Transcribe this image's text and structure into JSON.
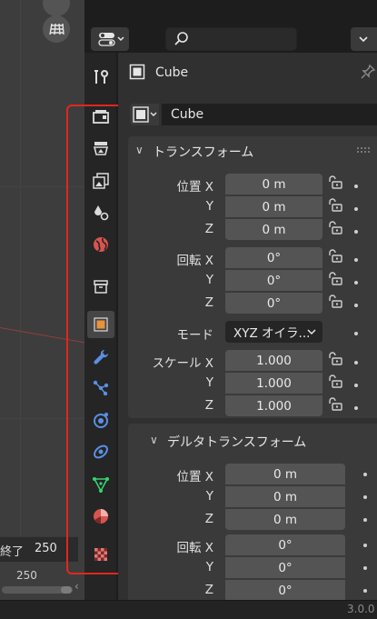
{
  "colors": {
    "accent_orange": "#e8923a",
    "tab_blue": "#5b8fe3",
    "tab_green": "#35d46f",
    "tab_red": "#d9544f",
    "highlight_red": "#e2261f",
    "field_bg": "#545454",
    "panel_bg": "#3a3a3a"
  },
  "viewport": {
    "timeline_end_label": "終了",
    "timeline_end_value": "250",
    "timeline_frame": "250"
  },
  "header": {
    "editor_icon": "properties-editor-icon",
    "search_icon": "search-icon"
  },
  "tabs": [
    {
      "name": "tool",
      "icon": "tool-icon"
    },
    {
      "name": "render",
      "icon": "render-icon"
    },
    {
      "name": "output",
      "icon": "output-icon"
    },
    {
      "name": "view-layer",
      "icon": "view-layer-icon"
    },
    {
      "name": "scene",
      "icon": "scene-icon"
    },
    {
      "name": "world",
      "icon": "world-icon"
    },
    {
      "name": "collection",
      "icon": "collection-icon"
    },
    {
      "name": "object",
      "icon": "object-icon",
      "active": true
    },
    {
      "name": "modifiers",
      "icon": "wrench-icon"
    },
    {
      "name": "particles",
      "icon": "particles-icon"
    },
    {
      "name": "physics",
      "icon": "physics-icon"
    },
    {
      "name": "constraints",
      "icon": "constraints-icon"
    },
    {
      "name": "data",
      "icon": "mesh-data-icon"
    },
    {
      "name": "material",
      "icon": "material-icon"
    },
    {
      "name": "texture",
      "icon": "texture-icon"
    }
  ],
  "object": {
    "name": "Cube",
    "datablock_name": "Cube"
  },
  "transform": {
    "title": "トランスフォーム",
    "location_label": "位置 X",
    "location": [
      "0 m",
      "0 m",
      "0 m"
    ],
    "rotation_label": "回転 X",
    "rotation": [
      "0°",
      "0°",
      "0°"
    ],
    "mode_label": "モード",
    "mode_value": "XYZ オイラ...",
    "scale_label": "スケール X",
    "scale": [
      "1.000",
      "1.000",
      "1.000"
    ],
    "axis_y": "Y",
    "axis_z": "Z"
  },
  "delta": {
    "title": "デルタトランスフォーム",
    "location_label": "位置 X",
    "location": [
      "0 m",
      "0 m",
      "0 m"
    ],
    "rotation_label": "回転 X",
    "rotation": [
      "0°",
      "0°",
      "0°"
    ],
    "axis_y": "Y",
    "axis_z": "Z"
  },
  "status": {
    "version": "3.0.0"
  }
}
